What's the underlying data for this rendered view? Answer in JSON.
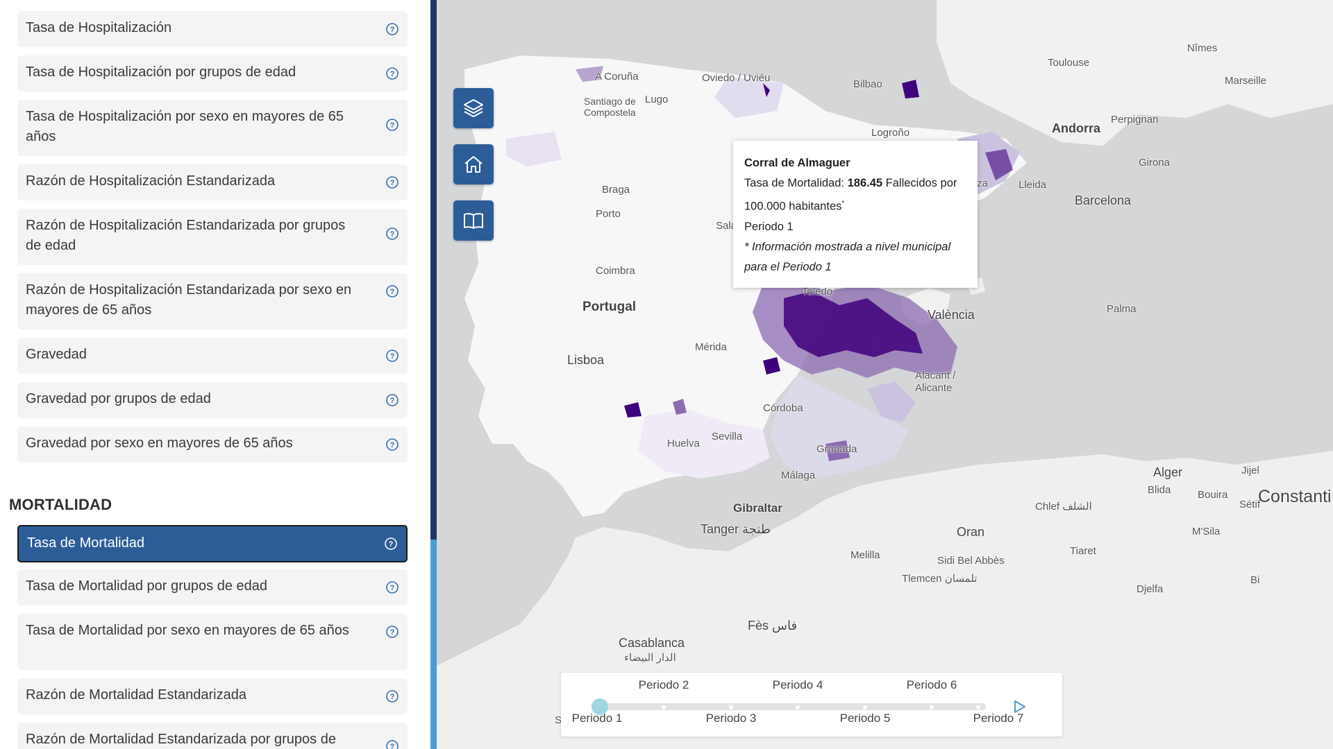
{
  "sidebar": {
    "items_top": [
      {
        "label": "Tasa de Hospitalización"
      },
      {
        "label": "Tasa de Hospitalización por grupos de edad"
      },
      {
        "label": "Tasa de Hospitalización por sexo en mayores de 65 años"
      },
      {
        "label": "Razón de Hospitalización Estandarizada"
      },
      {
        "label": "Razón de Hospitalización Estandarizada por grupos de edad"
      },
      {
        "label": "Razón de Hospitalización Estandarizada por sexo en mayores de 65 años"
      },
      {
        "label": "Gravedad"
      },
      {
        "label": "Gravedad por grupos de edad"
      },
      {
        "label": "Gravedad por sexo en mayores de 65 años"
      }
    ],
    "section_title": "MORTALIDAD",
    "items_bottom": [
      {
        "label": "Tasa de Mortalidad",
        "active": true
      },
      {
        "label": "Tasa de Mortalidad por grupos de edad"
      },
      {
        "label": "Tasa de Mortalidad por sexo en mayores de 65 años"
      },
      {
        "label": "Razón de Mortalidad Estandarizada"
      },
      {
        "label": "Razón de Mortalidad Estandarizada por grupos de"
      }
    ]
  },
  "map": {
    "buttons": [
      {
        "icon": "layers-icon"
      },
      {
        "icon": "home-icon"
      },
      {
        "icon": "book-icon"
      }
    ],
    "labels": {
      "acoruna": "A Coruña",
      "santiago": "Santiago de Compostela",
      "lugo": "Lugo",
      "oviedo": "Oviedo / Uviéu",
      "bilbao": "Bilbao",
      "logrono": "Logroño",
      "toulouse": "Toulouse",
      "nimes": "Nîmes",
      "marseille": "Marseille",
      "perpignan": "Perpignan",
      "andorra": "Andorra",
      "girona": "Girona",
      "lleida": "Lleida",
      "barcelona": "Barcelona",
      "zaragoza_part": "za",
      "braga": "Braga",
      "porto": "Porto",
      "salamanca_part": "Sala",
      "coimbra": "Coimbra",
      "portugal": "Portugal",
      "toledo": "Toledo",
      "valencia": "València",
      "palma": "Palma",
      "merida": "Mérida",
      "lisboa": "Lisboa",
      "alicante": "Alacant / Alicante",
      "cordoba": "Córdoba",
      "huelva": "Huelva",
      "sevilla": "Sevilla",
      "granada": "Granada",
      "malaga": "Málaga",
      "gibraltar": "Gibraltar",
      "tanger": "Tanger طنجة",
      "alger": "Alger",
      "blida": "Blida",
      "bouira": "Bouira",
      "jijel": "Jijel",
      "setif": "Sétif",
      "constantine": "Constanti",
      "chlef": "Chlef الشلف",
      "oran": "Oran",
      "msila": "M'Sila",
      "tiaret": "Tiaret",
      "melilla": "Melilla",
      "sidibel": "Sidi Bel Abbès",
      "tlemcen": "Tlemcen تلمسان",
      "djelfa": "Djelfa",
      "biskra_part": "Bi",
      "fes": "Fès فاس",
      "casablanca": "Casablanca",
      "casablanca_ar": "الدار البيضاء",
      "s_part": "S"
    },
    "tooltip": {
      "name": "Corral de Almaguer",
      "metric_label": "Tasa de Mortalidad: ",
      "value": "186.45",
      "unit": " Fallecidos por 100.000 habitantes",
      "sup": "*",
      "period": "Periodo 1",
      "note": "* Información mostrada a nivel municipal para el Periodo 1"
    },
    "timeline": {
      "periods_top": [
        "Periodo 2",
        "Periodo 4",
        "Periodo 6"
      ],
      "periods_bottom": [
        "Periodo 1",
        "Periodo 3",
        "Periodo 5",
        "Periodo 7"
      ],
      "selected_index": 0
    }
  },
  "colors": {
    "accent": "#2c5d97",
    "divider_dark": "#1d3664",
    "divider_light": "#4b9ad8",
    "choropleth_dark": "#3f007d",
    "choropleth_mid": "#8c6bb1",
    "choropleth_light": "#dadaeb"
  }
}
